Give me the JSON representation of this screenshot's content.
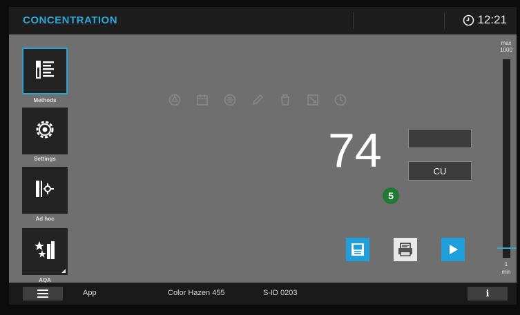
{
  "header": {
    "title": "CONCENTRATION",
    "time": "12:21"
  },
  "sidebar": {
    "items": [
      {
        "label": "Methods",
        "icon": "methods-icon",
        "selected": true
      },
      {
        "label": "Settings",
        "icon": "settings-gear-icon",
        "selected": false
      },
      {
        "label": "Ad hoc",
        "icon": "ad-hoc-icon",
        "selected": false
      },
      {
        "label": "AQA",
        "icon": "aqa-stars-icon",
        "selected": false
      }
    ]
  },
  "measurement": {
    "value": "74",
    "unit": "CU",
    "badge": "5",
    "status_icons": [
      "recycle-icon",
      "calendar-icon",
      "chart-icon",
      "pencil-icon",
      "bottle-icon",
      "resize-icon",
      "clock-icon"
    ]
  },
  "scale": {
    "max_label": "max",
    "max_value": "1000",
    "min_value": "1",
    "min_label": "min",
    "level": 0.05
  },
  "actions": [
    {
      "name": "save-button",
      "icon": "floppy-icon"
    },
    {
      "name": "print-button",
      "icon": "printer-icon"
    },
    {
      "name": "start-button",
      "icon": "play-icon"
    }
  ],
  "footer": {
    "app": "App",
    "method": "Color Hazen 455",
    "sample_id": "S-ID 0203",
    "info": "i"
  },
  "colors": {
    "accent": "#2ea7db",
    "background": "#6f6f6f",
    "header": "#1d1d1d",
    "badge": "#1f7a34"
  }
}
